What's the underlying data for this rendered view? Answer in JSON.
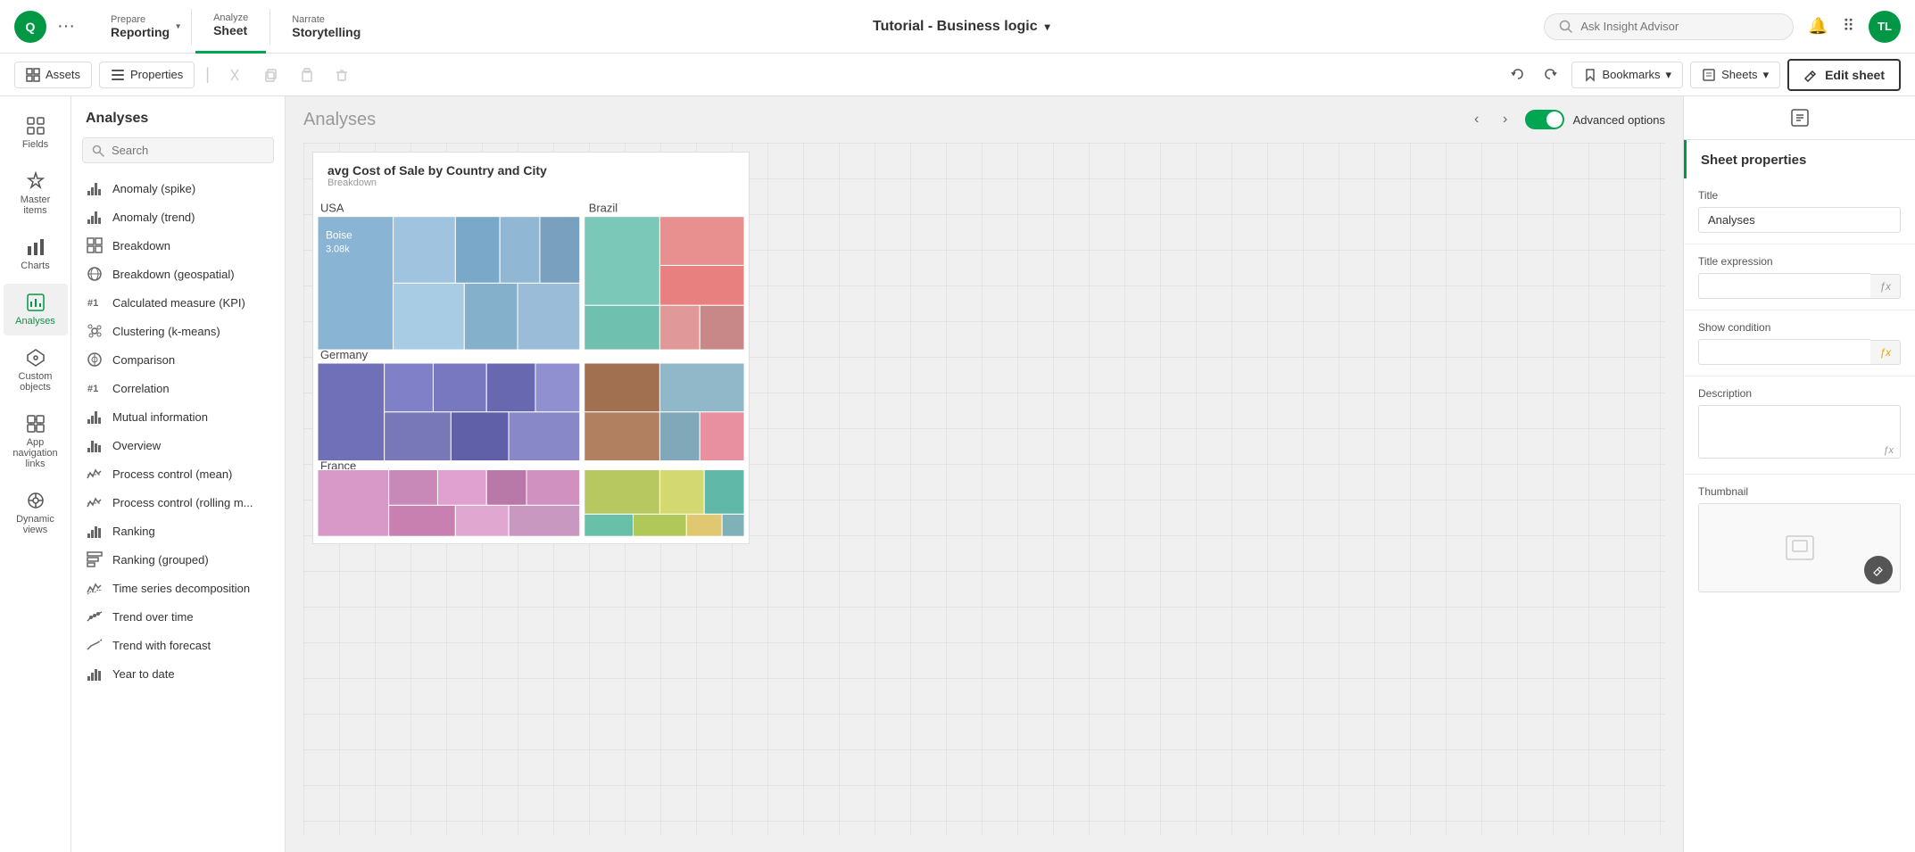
{
  "app": {
    "title": "Tutorial - Business logic",
    "user_initials": "TL"
  },
  "nav": {
    "prepare_label": "Prepare",
    "prepare_sub": "Reporting",
    "analyze_label": "Analyze",
    "analyze_sub": "Sheet",
    "narrate_label": "Narrate",
    "narrate_sub": "Storytelling"
  },
  "toolbar": {
    "assets_label": "Assets",
    "properties_label": "Properties",
    "undo_label": "↩",
    "redo_label": "↪",
    "bookmarks_label": "Bookmarks",
    "sheets_label": "Sheets",
    "edit_sheet_label": "Edit sheet"
  },
  "search": {
    "placeholder": "Ask Insight Advisor"
  },
  "sidebar_icons": [
    {
      "id": "fields",
      "label": "Fields",
      "icon": "⊞"
    },
    {
      "id": "master-items",
      "label": "Master items",
      "icon": "✦"
    },
    {
      "id": "charts",
      "label": "Charts",
      "icon": "▦"
    },
    {
      "id": "analyses",
      "label": "Analyses",
      "icon": "⊠",
      "active": true
    },
    {
      "id": "custom-objects",
      "label": "Custom objects",
      "icon": "❖"
    },
    {
      "id": "app-nav",
      "label": "App navigation links",
      "icon": "⧉"
    },
    {
      "id": "dynamic-views",
      "label": "Dynamic views",
      "icon": "◈"
    }
  ],
  "analyses_panel": {
    "title": "Analyses",
    "search_placeholder": "Search",
    "items": [
      {
        "id": "anomaly-spike",
        "label": "Anomaly (spike)",
        "icon": "📊"
      },
      {
        "id": "anomaly-trend",
        "label": "Anomaly (trend)",
        "icon": "📊"
      },
      {
        "id": "breakdown",
        "label": "Breakdown",
        "icon": "▦"
      },
      {
        "id": "breakdown-geo",
        "label": "Breakdown (geospatial)",
        "icon": "🌐"
      },
      {
        "id": "calc-measure",
        "label": "Calculated measure (KPI)",
        "icon": "#1"
      },
      {
        "id": "clustering",
        "label": "Clustering (k-means)",
        "icon": "⊙"
      },
      {
        "id": "comparison",
        "label": "Comparison",
        "icon": "⊙"
      },
      {
        "id": "correlation",
        "label": "Correlation",
        "icon": "#1"
      },
      {
        "id": "mutual-info",
        "label": "Mutual information",
        "icon": "📊"
      },
      {
        "id": "overview",
        "label": "Overview",
        "icon": "📊"
      },
      {
        "id": "process-mean",
        "label": "Process control (mean)",
        "icon": "📈"
      },
      {
        "id": "process-rolling",
        "label": "Process control (rolling m...",
        "icon": "📈"
      },
      {
        "id": "ranking",
        "label": "Ranking",
        "icon": "📊"
      },
      {
        "id": "ranking-grouped",
        "label": "Ranking (grouped)",
        "icon": "▦"
      },
      {
        "id": "time-series",
        "label": "Time series decomposition",
        "icon": "📈"
      },
      {
        "id": "trend-time",
        "label": "Trend over time",
        "icon": "📈"
      },
      {
        "id": "trend-forecast",
        "label": "Trend with forecast",
        "icon": "📈"
      },
      {
        "id": "year-date",
        "label": "Year to date",
        "icon": "📊"
      }
    ]
  },
  "sheet": {
    "title": "Analyses",
    "advanced_options_label": "Advanced options"
  },
  "chart": {
    "title": "avg Cost of Sale by Country and City",
    "subtitle": "Breakdown",
    "regions": {
      "usa": {
        "label": "USA",
        "city": "Boise",
        "value": "3.08k"
      },
      "brazil": {
        "label": "Brazil"
      },
      "germany": {
        "label": "Germany"
      },
      "france": {
        "label": "France"
      }
    }
  },
  "properties": {
    "title": "Sheet properties",
    "title_field_label": "Title",
    "title_field_value": "Analyses",
    "title_expr_label": "Title expression",
    "title_expr_value": "",
    "show_condition_label": "Show condition",
    "show_condition_value": "",
    "description_label": "Description",
    "description_value": "",
    "thumbnail_label": "Thumbnail"
  }
}
